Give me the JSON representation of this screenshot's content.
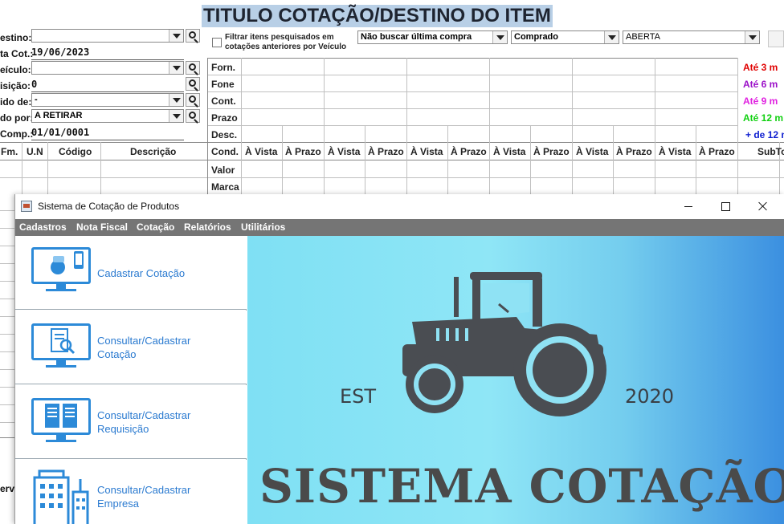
{
  "form": {
    "title": "TITULO COTAÇÃO/DESTINO DO ITEM",
    "fields": [
      {
        "label": "estino:",
        "value": ""
      },
      {
        "label": "ta Cot.:",
        "value": "19/06/2023"
      },
      {
        "label": "eículo:",
        "value": ""
      },
      {
        "label": "isição:",
        "value": "0"
      },
      {
        "label": "ido de:",
        "value": "-"
      },
      {
        "label": "do por:",
        "value": "A RETIRAR"
      },
      {
        "label": "Comp.:",
        "value": "01/01/0001"
      }
    ],
    "filter_checkbox_label_1": "Filtrar itens pesquisados em",
    "filter_checkbox_label_2": "cotações anteriores por Veículo",
    "combo_last_purchase": "Não buscar última compra",
    "combo_status": "Comprado",
    "combo_state": "ABERTA",
    "row_labels": [
      "Forn.",
      "Fone",
      "Cont.",
      "Prazo",
      "Desc.",
      "Cond.",
      "Valor",
      "Marca"
    ],
    "item_headers": [
      "Fm.",
      "U.N",
      "Código",
      "Descrição"
    ],
    "cond_a_vista": "À Vista",
    "cond_a_prazo": "À Prazo",
    "subtotal_header": "SubTo",
    "legend": [
      {
        "text": "Até 3 m",
        "color": "#e00000"
      },
      {
        "text": "Até 6 m",
        "color": "#9b10c8"
      },
      {
        "text": "Até 9 m",
        "color": "#e020e0"
      },
      {
        "text": "Até 12 m",
        "color": "#10d010"
      },
      {
        "text": "+ de 12 m",
        "color": "#1020d0"
      }
    ],
    "partial_label_bottom": "erv"
  },
  "window": {
    "title": "Sistema de Cotação de Produtos",
    "menu": [
      "Cadastros",
      "Nota Fiscal",
      "Cotação",
      "Relatórios",
      "Utilitários"
    ],
    "side_buttons": [
      {
        "line1": "Cadastrar Cotação",
        "line2": "",
        "icon": "quote-register-icon"
      },
      {
        "line1": "Consultar/Cadastrar",
        "line2": "Cotação",
        "icon": "quote-search-icon"
      },
      {
        "line1": "Consultar/Cadastrar",
        "line2": "Requisição",
        "icon": "requisition-icon"
      },
      {
        "line1": "Consultar/Cadastrar",
        "line2": "Empresa",
        "icon": "company-building-icon"
      }
    ],
    "banner": {
      "est": "EST",
      "year": "2020",
      "brand": "SISTEMA COTAÇÃO",
      "logo_icon": "tractor-icon"
    },
    "accent_color": "#2a7ad0",
    "menubar_color": "#757575"
  }
}
